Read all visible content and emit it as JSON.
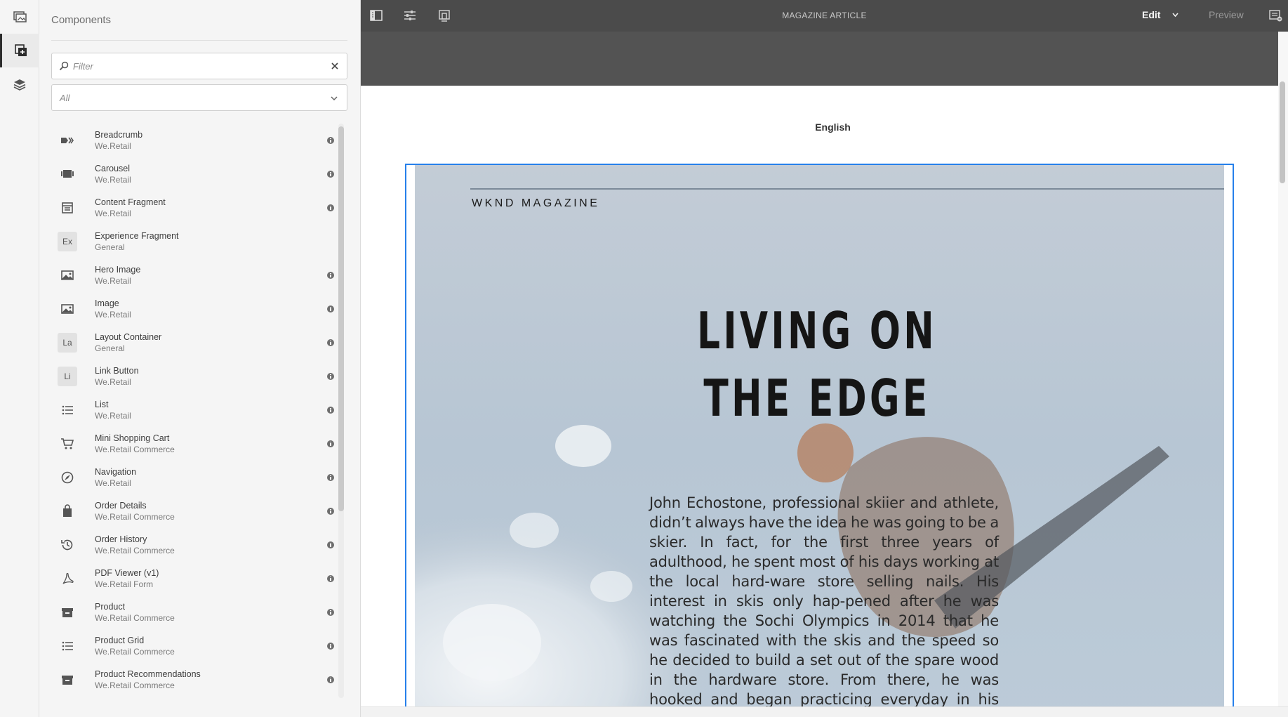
{
  "app": {
    "document_title": "MAGAZINE ARTICLE",
    "mode": {
      "edit_label": "Edit",
      "preview_label": "Preview"
    }
  },
  "rail": {
    "items": [
      {
        "name": "assets-icon",
        "active": false
      },
      {
        "name": "components-icon",
        "active": true
      },
      {
        "name": "content-tree-icon",
        "active": false
      }
    ]
  },
  "panel": {
    "title": "Components",
    "filter": {
      "placeholder": "Filter",
      "value": ""
    },
    "group_select": {
      "selected": "All"
    },
    "components": [
      {
        "name": "Breadcrumb",
        "group": "We.Retail",
        "icon": "breadcrumb-icon",
        "info": true
      },
      {
        "name": "Carousel",
        "group": "We.Retail",
        "icon": "carousel-icon",
        "info": true
      },
      {
        "name": "Content Fragment",
        "group": "We.Retail",
        "icon": "content-fragment-icon",
        "info": true
      },
      {
        "name": "Experience Fragment",
        "group": "General",
        "abbr": "Ex",
        "info": false
      },
      {
        "name": "Hero Image",
        "group": "We.Retail",
        "icon": "image-icon",
        "info": true
      },
      {
        "name": "Image",
        "group": "We.Retail",
        "icon": "image-icon",
        "info": true
      },
      {
        "name": "Layout Container",
        "group": "General",
        "abbr": "La",
        "info": true
      },
      {
        "name": "Link Button",
        "group": "We.Retail",
        "abbr": "Li",
        "info": true
      },
      {
        "name": "List",
        "group": "We.Retail",
        "icon": "list-icon",
        "info": true
      },
      {
        "name": "Mini Shopping Cart",
        "group": "We.Retail Commerce",
        "icon": "cart-icon",
        "info": true
      },
      {
        "name": "Navigation",
        "group": "We.Retail",
        "icon": "compass-icon",
        "info": true
      },
      {
        "name": "Order Details",
        "group": "We.Retail Commerce",
        "icon": "shopping-bag-icon",
        "info": true
      },
      {
        "name": "Order History",
        "group": "We.Retail Commerce",
        "icon": "history-icon",
        "info": true
      },
      {
        "name": "PDF Viewer (v1)",
        "group": "We.Retail Form",
        "icon": "pdf-icon",
        "info": true
      },
      {
        "name": "Product",
        "group": "We.Retail Commerce",
        "icon": "box-icon",
        "info": true
      },
      {
        "name": "Product Grid",
        "group": "We.Retail Commerce",
        "icon": "list-icon",
        "info": true
      },
      {
        "name": "Product Recommendations",
        "group": "We.Retail Commerce",
        "icon": "box-icon",
        "info": true
      }
    ]
  },
  "page": {
    "language": "English",
    "hero": {
      "magazine": "WKND MAGAZINE",
      "title": "LIVING ON THE EDGE",
      "body": "John Echostone, professional skiier and athlete, didn’t always have the idea he was going to be a skier. In fact, for the first three years of adulthood, he spent most of his days working at the local hard-ware store selling nails. His interest in skis only hap-pened after he was watching the Sochi Olympics in 2014 that he was fascinated with the skis and the speed so he decided to build a set out of the spare wood in the hardware store. From there, he was hooked and began practicing everyday in his local town of Ogden in Utah."
    }
  },
  "colors": {
    "topbar": "#4b4b4b",
    "panel_bg": "#f5f5f5",
    "selection_outline": "#2680eb",
    "hero_sky": "#b8c7d6"
  }
}
